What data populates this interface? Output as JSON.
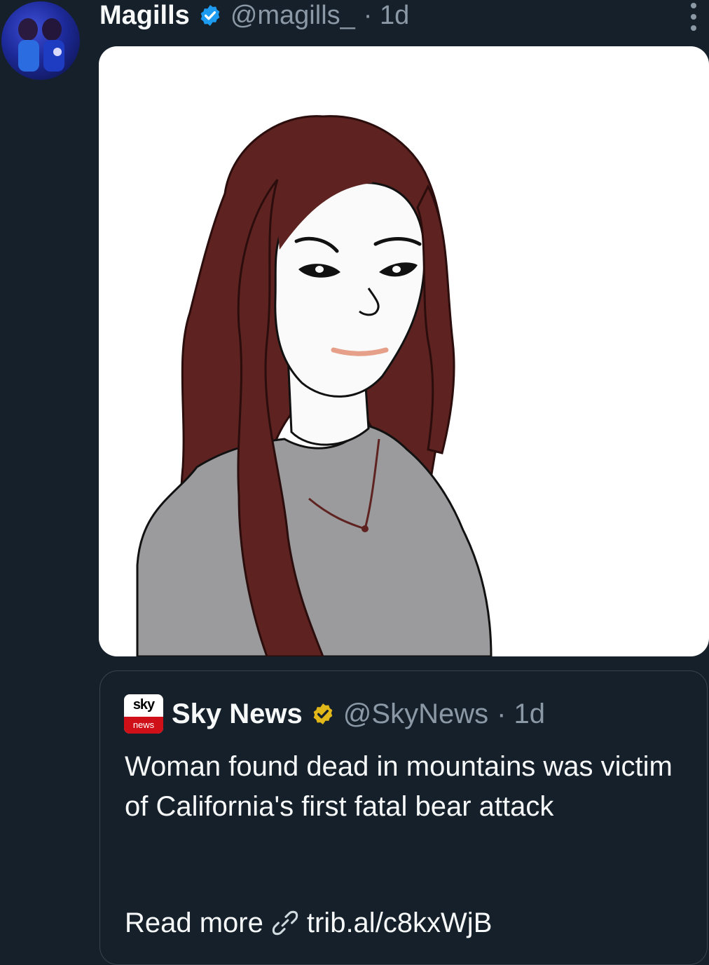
{
  "tweet": {
    "author_name": "Magills",
    "handle": "@magills_",
    "time": "· 1d"
  },
  "quote": {
    "author_name": "Sky News",
    "handle": "@SkyNews",
    "time": "· 1d",
    "logo_top": "sky",
    "logo_bottom": "news",
    "text": "Woman found dead in mountains was victim of California's first fatal bear attack",
    "read_more": "Read more",
    "link": "trib.al/c8kxWjB"
  },
  "icons": {
    "verified_author": "verified-badge-blue",
    "verified_quote": "verified-badge-gold",
    "more": "more-vertical-icon",
    "link": "link-icon"
  },
  "colors": {
    "background": "#15202b",
    "secondary_text": "#8b98a5",
    "verified_blue": "#1d9bf0",
    "verified_gold": "#e2b719"
  }
}
